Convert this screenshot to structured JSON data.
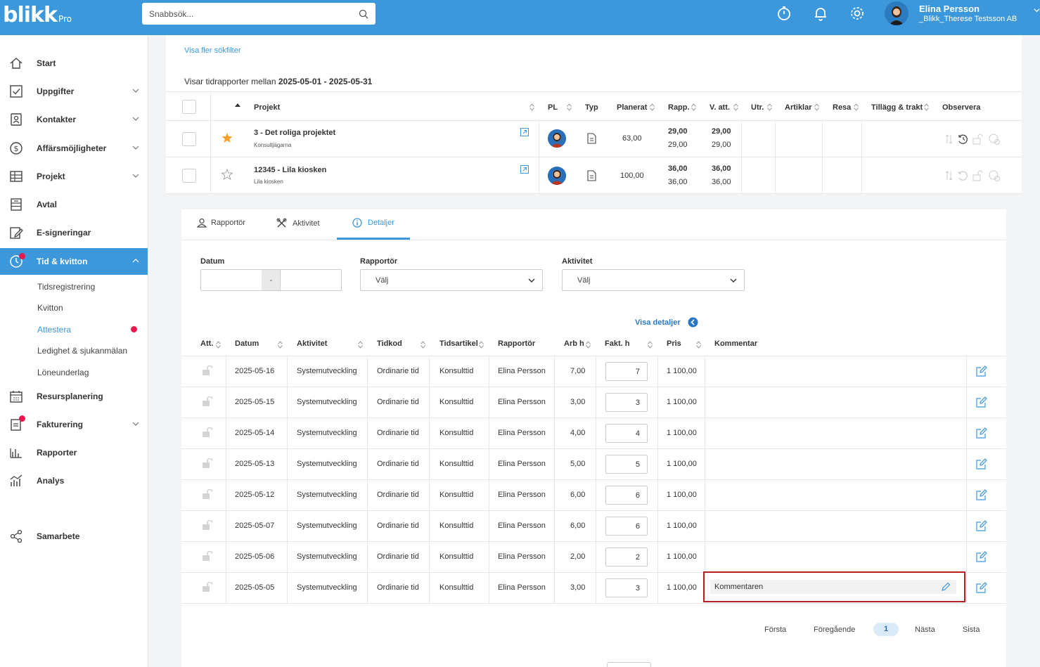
{
  "header": {
    "logo_text": "blikk",
    "logo_sub": "Pro",
    "search_placeholder": "Snabbsök...",
    "user_name": "Elina Persson",
    "user_company": "_Blikk_Therese Testsson AB",
    "accent_color": "#3c98db"
  },
  "sidebar": {
    "items": [
      {
        "label": "Start",
        "icon": "home-icon"
      },
      {
        "label": "Uppgifter",
        "icon": "checkbox-icon"
      },
      {
        "label": "Kontakter",
        "icon": "contacts-icon"
      },
      {
        "label": "Affärsmöjligheter",
        "icon": "dollar-icon"
      },
      {
        "label": "Projekt",
        "icon": "table-icon"
      },
      {
        "label": "Avtal",
        "icon": "contract-icon"
      },
      {
        "label": "E-signeringar",
        "icon": "signature-icon"
      },
      {
        "label": "Tid & kvitton",
        "icon": "clock-icon"
      },
      {
        "label": "Resursplanering",
        "icon": "calendar-icon"
      },
      {
        "label": "Fakturering",
        "icon": "invoice-icon"
      },
      {
        "label": "Rapporter",
        "icon": "bar-chart-icon"
      },
      {
        "label": "Analys",
        "icon": "analytics-icon"
      },
      {
        "label": "Samarbete",
        "icon": "share-icon"
      }
    ],
    "sub_items": [
      "Tidsregistrering",
      "Kvitton",
      "Attestera",
      "Ledighet & sjukanmälan",
      "Löneunderlag"
    ]
  },
  "top": {
    "more_filters": "Visa fler sökfilter",
    "showing_prefix": "Visar tidrapporter mellan",
    "showing_range": "2025-05-01 - 2025-05-31",
    "columns": [
      "Projekt",
      "PL",
      "Typ",
      "Planerat",
      "Rapp.",
      "V. att.",
      "Utr.",
      "Artiklar",
      "Resa",
      "Tillägg & trakt",
      "Observera"
    ],
    "projects": [
      {
        "name": "3 - Det roliga projektet",
        "customer": "Konsultjägarna",
        "planned": "63,00",
        "rapp_a": "29,00",
        "rapp_b": "29,00",
        "vatt_a": "29,00",
        "vatt_b": "29,00"
      },
      {
        "name": "12345 - Lila kiosken",
        "customer": "Lila kiosken",
        "planned": "100,00",
        "rapp_a": "36,00",
        "rapp_b": "36,00",
        "vatt_a": "36,00",
        "vatt_b": "36,00"
      }
    ]
  },
  "tabs": [
    "Rapportör",
    "Aktivitet",
    "Detaljer"
  ],
  "filters": {
    "date_label": "Datum",
    "date_sep": "-",
    "reporter_label": "Rapportör",
    "reporter_value": "Välj",
    "activity_label": "Aktivitet",
    "activity_value": "Välj"
  },
  "details_link": "Visa detaljer",
  "detail_columns": [
    "Att.",
    "Datum",
    "Aktivitet",
    "Tidkod",
    "Tidsartikel",
    "Rapportör",
    "Arb h",
    "Fakt. h",
    "Pris",
    "Kommentar"
  ],
  "rows": [
    {
      "date": "2025-05-16",
      "activity": "Systemutveckling",
      "code": "Ordinarie tid",
      "article": "Konsulttid",
      "reporter": "Elina Persson",
      "hours": "7,00",
      "fakt": "7",
      "price": "1 100,00",
      "comment": ""
    },
    {
      "date": "2025-05-15",
      "activity": "Systemutveckling",
      "code": "Ordinarie tid",
      "article": "Konsulttid",
      "reporter": "Elina Persson",
      "hours": "3,00",
      "fakt": "3",
      "price": "1 100,00",
      "comment": ""
    },
    {
      "date": "2025-05-14",
      "activity": "Systemutveckling",
      "code": "Ordinarie tid",
      "article": "Konsulttid",
      "reporter": "Elina Persson",
      "hours": "4,00",
      "fakt": "4",
      "price": "1 100,00",
      "comment": ""
    },
    {
      "date": "2025-05-13",
      "activity": "Systemutveckling",
      "code": "Ordinarie tid",
      "article": "Konsulttid",
      "reporter": "Elina Persson",
      "hours": "5,00",
      "fakt": "5",
      "price": "1 100,00",
      "comment": ""
    },
    {
      "date": "2025-05-12",
      "activity": "Systemutveckling",
      "code": "Ordinarie tid",
      "article": "Konsulttid",
      "reporter": "Elina Persson",
      "hours": "6,00",
      "fakt": "6",
      "price": "1 100,00",
      "comment": ""
    },
    {
      "date": "2025-05-07",
      "activity": "Systemutveckling",
      "code": "Ordinarie tid",
      "article": "Konsulttid",
      "reporter": "Elina Persson",
      "hours": "6,00",
      "fakt": "6",
      "price": "1 100,00",
      "comment": ""
    },
    {
      "date": "2025-05-06",
      "activity": "Systemutveckling",
      "code": "Ordinarie tid",
      "article": "Konsulttid",
      "reporter": "Elina Persson",
      "hours": "2,00",
      "fakt": "2",
      "price": "1 100,00",
      "comment": ""
    },
    {
      "date": "2025-05-05",
      "activity": "Systemutveckling",
      "code": "Ordinarie tid",
      "article": "Konsulttid",
      "reporter": "Elina Persson",
      "hours": "3,00",
      "fakt": "3",
      "price": "1 100,00",
      "comment": "Kommentaren"
    }
  ],
  "pagination": {
    "first": "Första",
    "prev": "Föregående",
    "current": "1",
    "next": "Nästa",
    "last": "Sista"
  }
}
